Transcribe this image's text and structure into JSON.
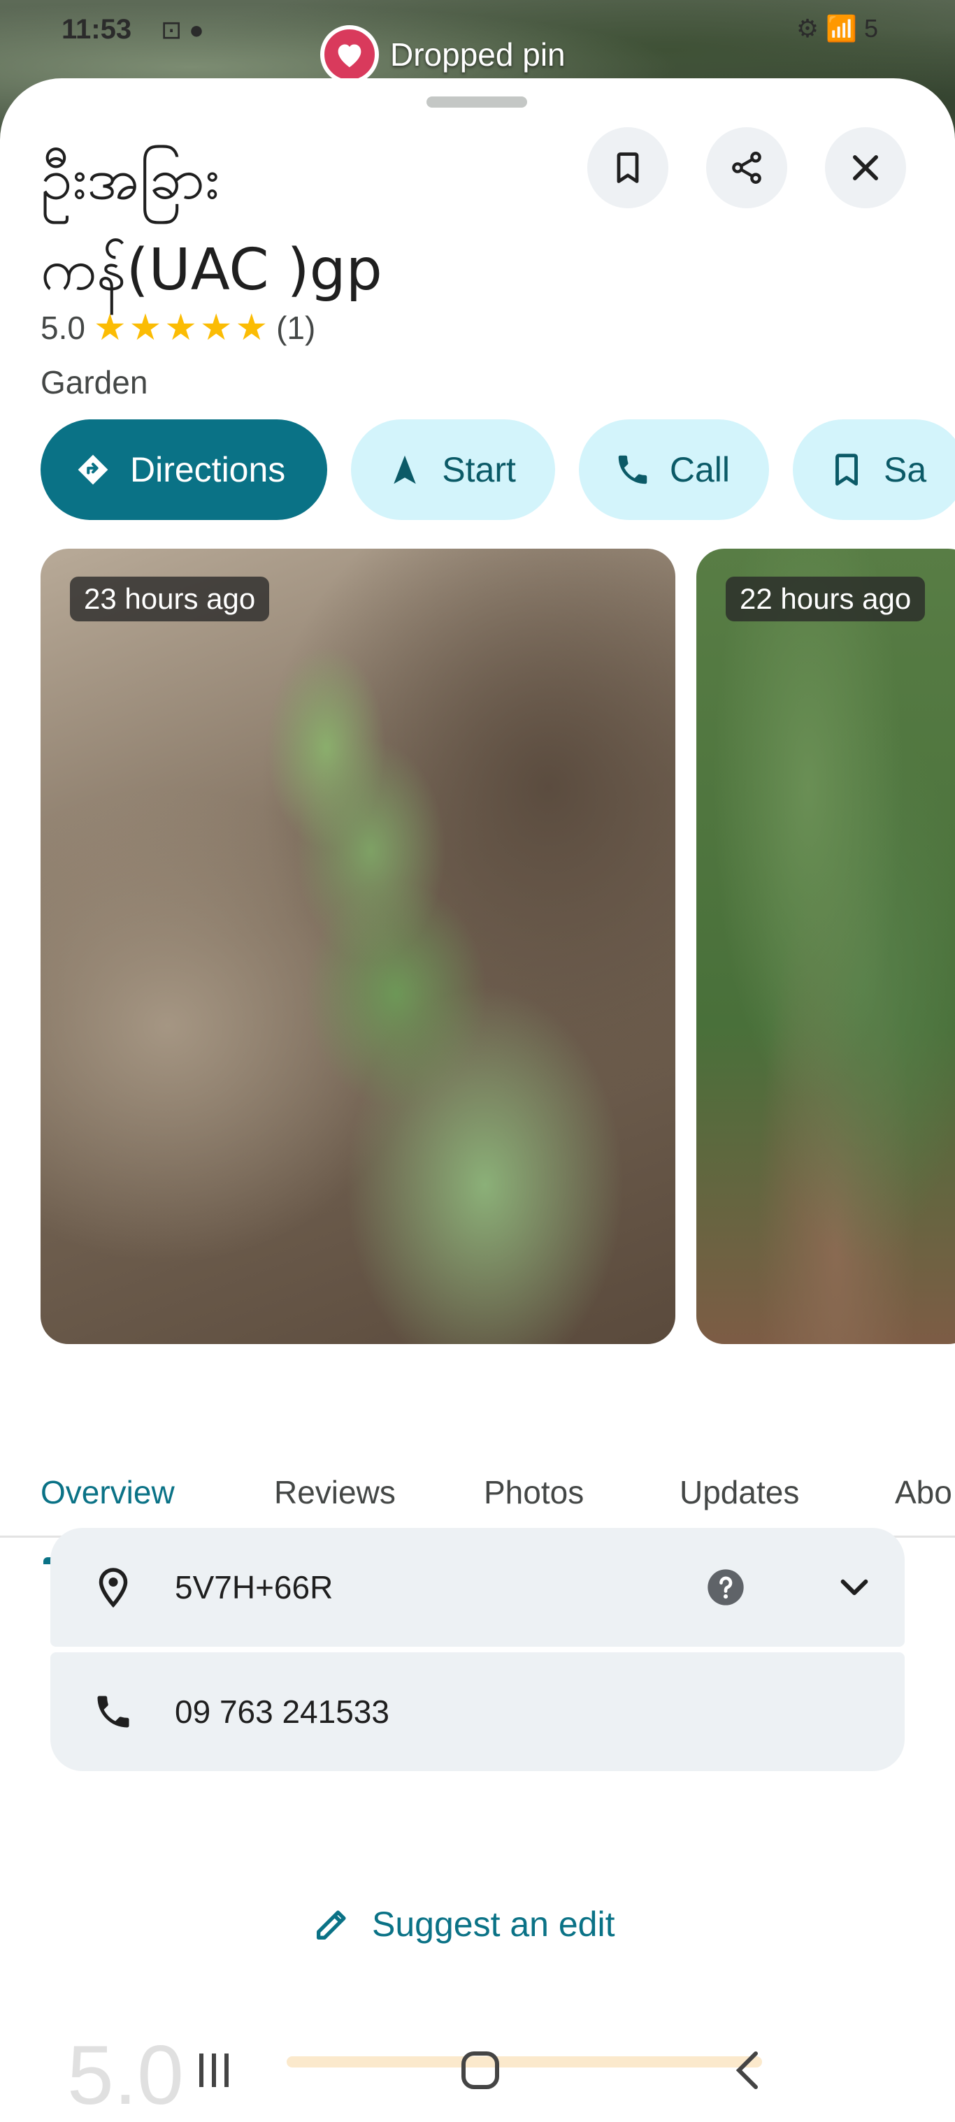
{
  "status_bar": {
    "time": "11:53",
    "icons": "⊡ ●",
    "right": "⚙ 📶 5"
  },
  "map": {
    "chip_label": "Dropped pin",
    "chip_icon": "heart-icon"
  },
  "place": {
    "name_line1": "ဦးအခြား",
    "name_line2": "ကန်(UAC )gp",
    "rating": "5.0",
    "stars": [
      "★",
      "★",
      "★",
      "★",
      "★"
    ],
    "review_count": "(1)",
    "category": "Garden"
  },
  "header_buttons": {
    "save_icon": "bookmark-icon",
    "share_icon": "share-icon",
    "close_icon": "close-icon"
  },
  "actions": [
    {
      "label": "Directions",
      "icon": "directions-icon"
    },
    {
      "label": "Start",
      "icon": "navigation-arrow-icon"
    },
    {
      "label": "Call",
      "icon": "phone-icon"
    },
    {
      "label": "Sa",
      "icon": "bookmark-icon"
    }
  ],
  "photos": [
    {
      "badge": "23 hours ago"
    },
    {
      "badge": "22 hours ago"
    }
  ],
  "tabs": [
    "Overview",
    "Reviews",
    "Photos",
    "Updates",
    "Abo"
  ],
  "active_tab": "Overview",
  "info": {
    "plus_code": "5V7H+66R",
    "phone": "09 763 241533"
  },
  "suggest_edit": "Suggest an edit",
  "ghost_rating": "5.0",
  "colors": {
    "accent": "#0a7286",
    "chip_bg": "#d3f4fb",
    "star": "#fbbc04",
    "card_bg": "#edf1f4"
  }
}
